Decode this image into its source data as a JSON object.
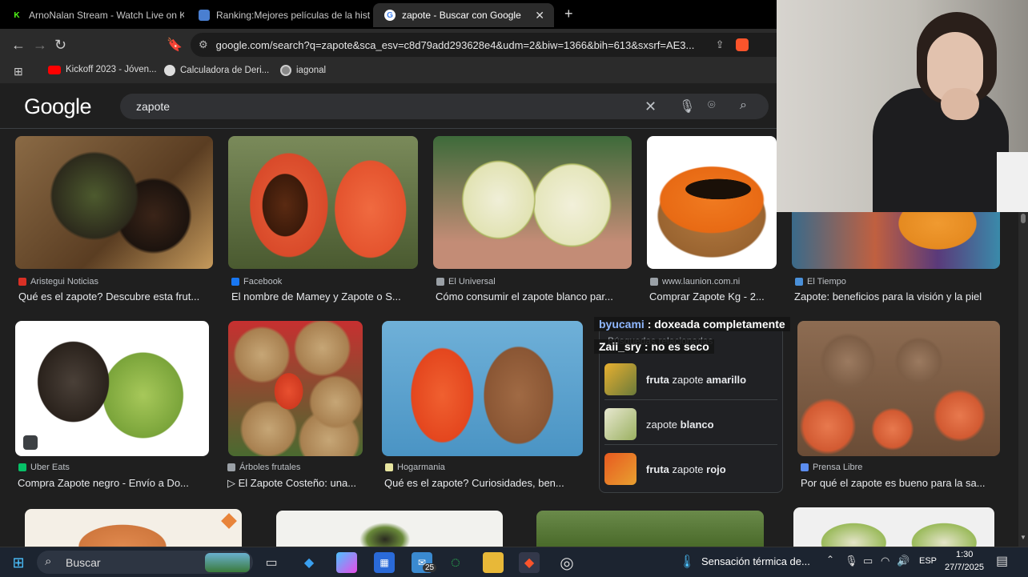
{
  "tabs": [
    {
      "label": "ArnoNalan Stream - Watch Live on Ki",
      "fav_color": "#53fc18",
      "fav_letter": "K"
    },
    {
      "label": "Ranking:Mejores películas de la histo",
      "fav_color": "#4a7fd1",
      "fav_letter": ""
    },
    {
      "label": "zapote - Buscar con Google",
      "fav_color": "#ffffff",
      "fav_letter": "G"
    }
  ],
  "address_bar": {
    "url": "google.com/search?q=zapote&sca_esv=c8d79add293628e4&udm=2&biw=1366&bih=613&sxsrf=AE3..."
  },
  "bookmarks": [
    {
      "label": "Kickoff 2023 - Jóven...",
      "color": "#ff0000"
    },
    {
      "label": "Calculadora de Deri...",
      "color": "#dddddd"
    },
    {
      "label": "iagonal",
      "color": "#bbbbbb"
    }
  ],
  "google": {
    "logo": "Google",
    "query": "zapote"
  },
  "results": [
    {
      "source": "Aristegui Noticias",
      "title": "Qué es el zapote? Descubre esta frut...",
      "src_color": "#d93025"
    },
    {
      "source": "Facebook",
      "title": "El nombre de Mamey y Zapote o S...",
      "src_color": "#1877f2"
    },
    {
      "source": "El Universal",
      "title": "Cómo consumir el zapote blanco par...",
      "src_color": "#9aa0a6"
    },
    {
      "source": "www.launion.com.ni",
      "title": "Comprar Zapote Kg - 2...",
      "src_color": "#9aa0a6"
    },
    {
      "source": "El Tiempo",
      "title": "Zapote: beneficios para la visión y la piel",
      "src_color": "#4a90d9"
    },
    {
      "source": "Uber Eats",
      "title": "Compra Zapote negro - Envío a Do...",
      "src_color": "#06c167"
    },
    {
      "source": "Árboles frutales",
      "title": "▷ El Zapote Costeño: una...",
      "src_color": "#9aa0a6"
    },
    {
      "source": "Hogarmania",
      "title": "Qué es el zapote? Curiosidades, ben...",
      "src_color": "#e8e6a0"
    },
    {
      "source": "Prensa Libre",
      "title": "Por qué el zapote es bueno para la sa...",
      "src_color": "#5b8def"
    }
  ],
  "related": {
    "header": "Búsquedas relacionadas",
    "items": [
      {
        "pre": "fruta",
        "mid": " zapote ",
        "post": "amarillo"
      },
      {
        "pre": "",
        "mid": "zapote ",
        "post": "blanco"
      },
      {
        "pre": "fruta",
        "mid": " zapote ",
        "post": "rojo"
      }
    ]
  },
  "chat": [
    {
      "user": "byucami",
      "message": " : doxeada completamente",
      "color": "#8fb7ff"
    },
    {
      "user": "Zaii_sry",
      "message": " : no es seco",
      "color": "#ffffff"
    }
  ],
  "taskbar": {
    "search_label": "Buscar",
    "weather": "Sensación térmica de...",
    "language": "ESP",
    "time": "1:30",
    "date": "27/7/2025",
    "mail_badge": "25"
  }
}
